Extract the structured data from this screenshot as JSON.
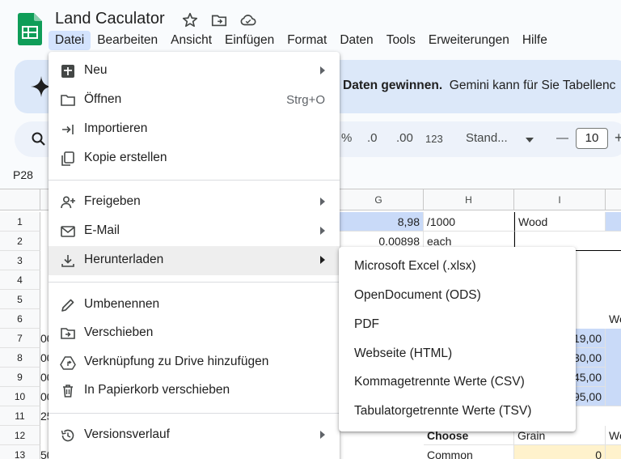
{
  "header": {
    "title": "Land Caculator",
    "menu": [
      "Datei",
      "Bearbeiten",
      "Ansicht",
      "Einfügen",
      "Format",
      "Daten",
      "Tools",
      "Erweiterungen",
      "Hilfe"
    ]
  },
  "banner": {
    "bold": "Daten gewinnen.",
    "text": "Gemini kann für Sie Tabellenc"
  },
  "toolbar": {
    "percent": "%",
    "dec_less": ".0",
    "dec_more": ".00",
    "number_format": "123",
    "font": "Stand...",
    "minus": "—",
    "font_size": "10",
    "plus": "+"
  },
  "namebox": "P28",
  "grid": {
    "columns": [
      "G",
      "H",
      "I"
    ],
    "rows": [
      "1",
      "2",
      "3",
      "4",
      "5",
      "6",
      "7",
      "8",
      "9",
      "10",
      "11",
      "12",
      "13"
    ],
    "g_values": [
      "8,98",
      "0.00898"
    ],
    "h_values": [
      "/1000",
      "each"
    ],
    "i1": "Wood",
    "i_values": [
      "19,00",
      "30,00",
      "45,00",
      "95,00"
    ],
    "left_fragments": [
      "00",
      "00",
      "00",
      "00",
      "25",
      "",
      "50"
    ],
    "h12": "Choose",
    "i12": "Grain",
    "h13": "Common",
    "i13": "0",
    "j6": "We",
    "j12": "We"
  },
  "menu": {
    "items": [
      {
        "label": "Neu"
      },
      {
        "label": "Öffnen",
        "shortcut": "Strg+O"
      },
      {
        "label": "Importieren"
      },
      {
        "label": "Kopie erstellen"
      },
      {
        "label": "Freigeben"
      },
      {
        "label": "E-Mail"
      },
      {
        "label": "Herunterladen"
      },
      {
        "label": "Umbenennen"
      },
      {
        "label": "Verschieben"
      },
      {
        "label": "Verknüpfung zu Drive hinzufügen"
      },
      {
        "label": "In Papierkorb verschieben"
      },
      {
        "label": "Versionsverlauf"
      }
    ]
  },
  "submenu": {
    "items": [
      "Microsoft Excel (.xlsx)",
      "OpenDocument (ODS)",
      "PDF",
      "Webseite (HTML)",
      "Kommagetrennte Werte (CSV)",
      "Tabulatorgetrennte Werte (TSV)"
    ]
  },
  "colors": {
    "sheets_green": "#0f9d58",
    "menu_active": "#d3e3fd",
    "cell_blue": "#c9daf8",
    "cell_yellow": "#fff2cc"
  }
}
